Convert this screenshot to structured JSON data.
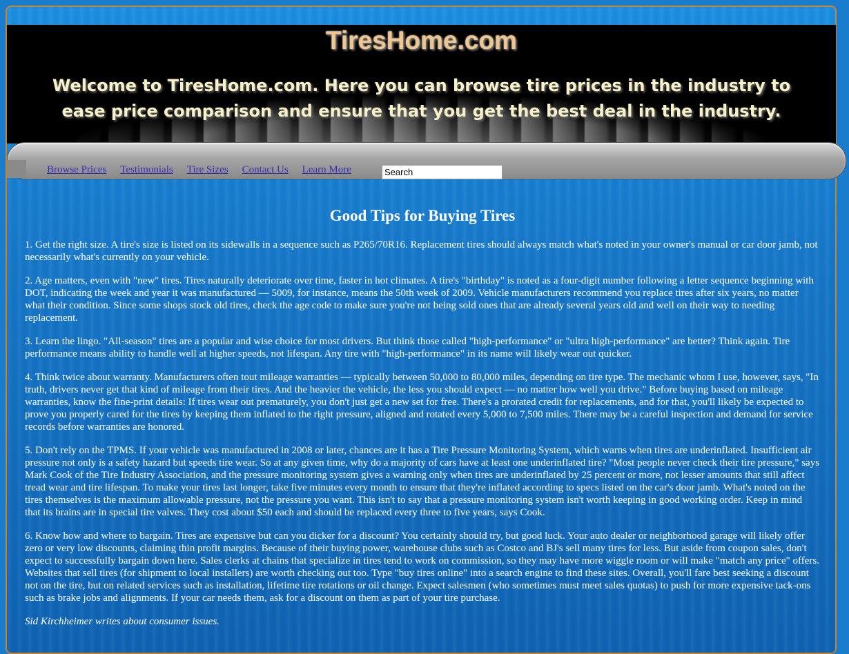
{
  "header": {
    "site_title": "TiresHome.com",
    "welcome_text": "Welcome to TiresHome.com. Here you can browse tire prices in the industry to ease price comparison and ensure that you get the best deal in the industry."
  },
  "nav": {
    "links": [
      "Browse Prices",
      "Testimonials",
      "Tire Sizes",
      "Contact Us",
      "Learn More"
    ],
    "search_value": "Search"
  },
  "article": {
    "title": "Good Tips for Buying Tires",
    "paragraphs": [
      "1. Get the right size. A tire's size is listed on its sidewalls in a sequence such as P265/70R16. Replacement tires should always match what's noted in your owner's manual or car door jamb, not necessarily what's currently on your vehicle.",
      "2. Age matters, even with \"new\" tires. Tires naturally deteriorate over time, faster in hot climates. A tire's \"birthday\" is noted as a four-digit number following a letter sequence beginning with DOT, indicating the week and year it was manufactured — 5009, for instance, means the 50th week of 2009. Vehicle manufacturers recommend you replace tires after six years, no matter what their condition. Since some shops stock old tires, check the age code to make sure you're not being sold ones that are already several years old and well on their way to needing replacement.",
      "3. Learn the lingo. \"All-season\" tires are a popular and wise choice for most drivers. But think those called \"high-performance\" or \"ultra high-performance\" are better? Think again. Tire performance means ability to handle well at higher speeds, not lifespan. Any tire with \"high-performance\" in its name will likely wear out quicker.",
      "4. Think twice about warranty. Manufacturers often tout mileage warranties — typically between 50,000 to 80,000 miles, depending on tire type. The mechanic whom I use, however, says, \"In truth, drivers never get that kind of mileage from their tires. And the heavier the vehicle, the less you should expect — no matter how well you drive.\" Before buying based on mileage warranties, know the fine-print details: If tires wear out prematurely, you don't just get a new set for free. There's a prorated credit for replacements, and for that, you'll likely be expected to prove you properly cared for the tires by keeping them inflated to the right pressure, aligned and rotated every 5,000 to 7,500 miles. There may be a careful inspection and demand for service records before warranties are honored.",
      "5. Don't rely on the TPMS. If your vehicle was manufactured in 2008 or later, chances are it has a Tire Pressure Monitoring System, which warns when tires are underinflated. Insufficient air pressure not only is a safety hazard but speeds tire wear. So at any given time, why do a majority of cars have at least one underinflated tire? \"Most people never check their tire pressure,\" says Mark Cook of the Tire Industry Association, and the pressure monitoring system gives a warning only when tires are underinflated by 25 percent or more, not lesser amounts that still affect tread wear and tire lifespan. To make your tires last longer, take five minutes every month to ensure that they're inflated according to specs listed on the car's door jamb. What's noted on the tires themselves is the maximum allowable pressure, not the pressure you want. This isn't to say that a pressure monitoring system isn't worth keeping in good working order. Keep in mind that its brains are in special tire valves. They cost about $50 each and should be replaced every three to five years, says Cook.",
      "6. Know how and where to bargain. Tires are expensive but can you dicker for a discount? You certainly should try, but good luck. Your auto dealer or neighborhood garage will likely offer zero or very low discounts, claiming thin profit margins. Because of their buying power, warehouse clubs such as Costco and BJ's sell many tires for less. But aside from coupon sales, don't expect to successfully bargain down here. Sales clerks at chains that specialize in tires tend to work on commission, so they may have more wiggle room or will make \"match any price\" offers. Websites that sell tires (for shipment to local installers) are worth checking out too. Type \"buy tires online\" into a search engine to find these sites. Overall, you'll fare best seeking a discount not on the tire, but on related services such as installation, lifetime tire rotations or oil change. Expect salesmen (who sometimes must meet sales quotas) to push for more expensive tack-ons such as brake jobs and alignments. If your car needs them, ask for a discount on them as part of your tire purchase."
    ],
    "byline": "Sid Kirchheimer writes about consumer issues."
  },
  "colors": {
    "background": "#1a7ccc",
    "frame_border": "#c9832a",
    "title_text": "#f0c690",
    "welcome_text": "#f7f1c9",
    "nav_link": "#3a2fb0"
  }
}
